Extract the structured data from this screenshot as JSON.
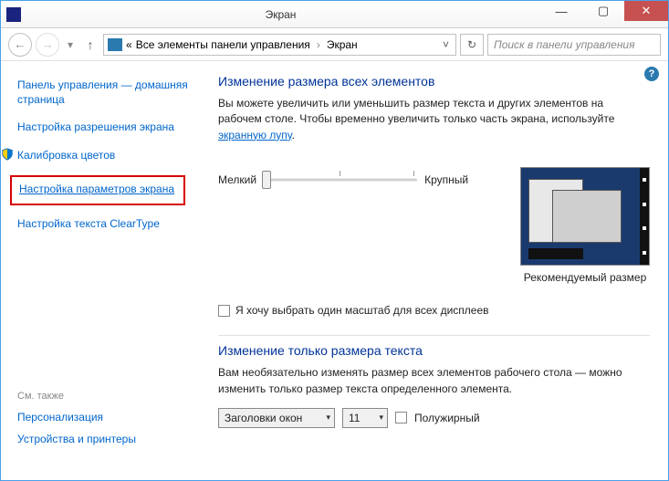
{
  "window": {
    "title": "Экран"
  },
  "nav": {
    "breadcrumb_root": "«",
    "breadcrumb_folder": "Все элементы панели управления",
    "breadcrumb_current": "Экран",
    "search_placeholder": "Поиск в панели управления"
  },
  "sidebar": {
    "home": "Панель управления — домашняя страница",
    "resolution": "Настройка разрешения экрана",
    "calibration": "Калибровка цветов",
    "display_settings": "Настройка параметров экрана",
    "cleartype": "Настройка текста ClearType",
    "see_also": "См. также",
    "personalization": "Персонализация",
    "devices": "Устройства и принтеры"
  },
  "main": {
    "heading1": "Изменение размера всех элементов",
    "desc1a": "Вы можете увеличить или уменьшить размер текста и других элементов на рабочем столе. Чтобы временно увеличить только часть экрана, используйте ",
    "desc1_link": "экранную лупу",
    "slider_min": "Мелкий",
    "slider_max": "Крупный",
    "preview_caption": "Рекомендуемый размер",
    "checkbox_label": "Я хочу выбрать один масштаб для всех дисплеев",
    "heading2": "Изменение только размера текста",
    "desc2": "Вам необязательно изменять размер всех элементов рабочего стола — можно изменить только размер текста определенного элемента.",
    "select_element": "Заголовки окон",
    "select_size": "11",
    "bold_label": "Полужирный"
  },
  "help": {
    "glyph": "?"
  }
}
